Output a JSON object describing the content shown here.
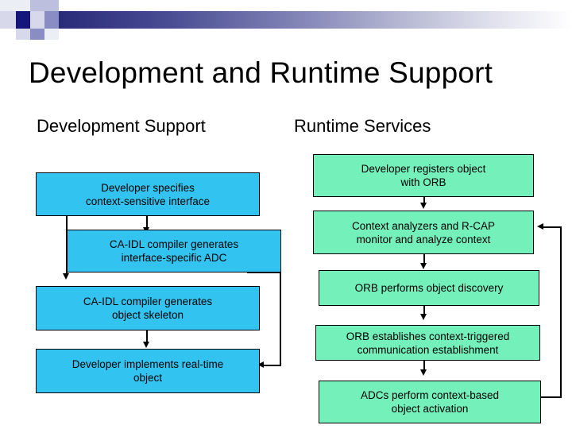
{
  "slide": {
    "title": "Development and Runtime Support",
    "columns": {
      "development_heading": "Development Support",
      "runtime_heading": "Runtime Services"
    },
    "colors": {
      "development_box_fill": "#33c3f0",
      "runtime_box_fill": "#74f0bb",
      "box_border": "#000000",
      "band_start": "#1d1f6e",
      "band_end": "#ffffff",
      "text": "#000000"
    }
  },
  "development_flow": {
    "steps": [
      {
        "id": "dev-1",
        "label": "Developer specifies\ncontext-sensitive interface"
      },
      {
        "id": "dev-2",
        "label": "CA-IDL compiler generates\ninterface-specific ADC"
      },
      {
        "id": "dev-3",
        "label": "CA-IDL compiler generates\nobject skeleton"
      },
      {
        "id": "dev-4",
        "label": "Developer implements real-time\nobject"
      }
    ]
  },
  "runtime_flow": {
    "steps": [
      {
        "id": "run-1",
        "label": "Developer registers object\nwith ORB"
      },
      {
        "id": "run-2",
        "label": "Context analyzers and R-CAP\nmonitor and analyze context"
      },
      {
        "id": "run-3",
        "label": "ORB performs object discovery"
      },
      {
        "id": "run-4",
        "label": "ORB establishes context-triggered\ncommunication establishment"
      },
      {
        "id": "run-5",
        "label": "ADCs perform context-based\nobject activation"
      }
    ]
  }
}
